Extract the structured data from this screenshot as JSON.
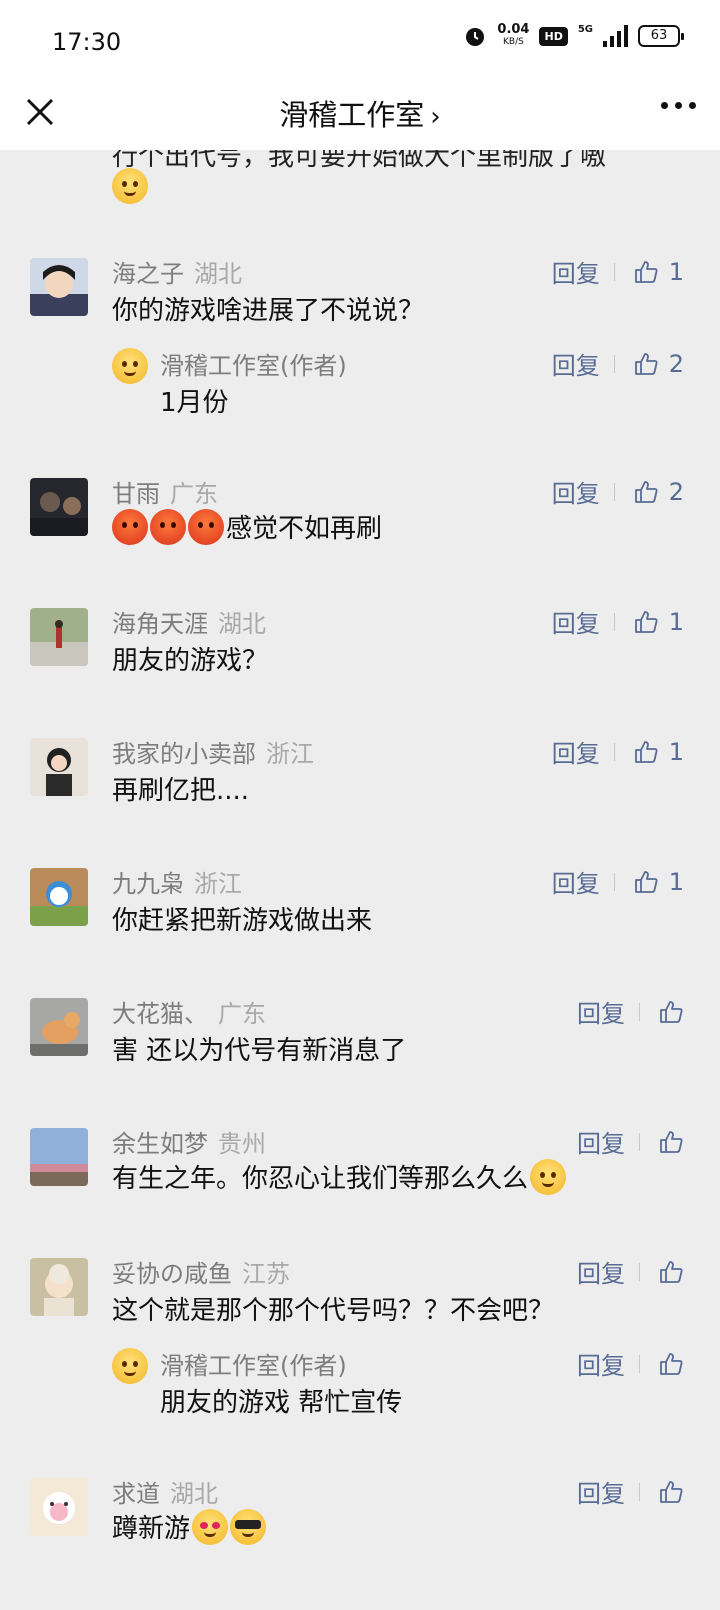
{
  "status_bar": {
    "time": "17:30",
    "net_speed": "0.04",
    "net_unit": "KB/S",
    "hd": "HD",
    "network": "5G",
    "battery": "63"
  },
  "nav": {
    "title": "滑稽工作室",
    "chevron": "›"
  },
  "truncated_comment": {
    "text": "行个出代号，我可要开始做大个里制版了嗷"
  },
  "comments": [
    {
      "author": "海之子",
      "region": "湖北",
      "text": "你的游戏啥进展了不说说？",
      "reply_label": "回复",
      "likes": "1",
      "reply": {
        "author": "滑稽工作室(作者)",
        "text": "1月份",
        "reply_label": "回复",
        "likes": "2"
      }
    },
    {
      "author": "甘雨",
      "region": "广东",
      "text": "感觉不如再刷",
      "reply_label": "回复",
      "likes": "2"
    },
    {
      "author": "海角天涯",
      "region": "湖北",
      "text": "朋友的游戏？",
      "reply_label": "回复",
      "likes": "1"
    },
    {
      "author": "我家的小卖部",
      "region": "浙江",
      "text": "再刷亿把....",
      "reply_label": "回复",
      "likes": "1"
    },
    {
      "author": "九九枭",
      "region": "浙江",
      "text": "你赶紧把新游戏做出来",
      "reply_label": "回复",
      "likes": "1"
    },
    {
      "author": "大花猫、",
      "region": "广东",
      "text": "害 还以为代号有新消息了",
      "reply_label": "回复",
      "likes": ""
    },
    {
      "author": "余生如梦",
      "region": "贵州",
      "text": "有生之年。你忍心让我们等那么久么",
      "reply_label": "回复",
      "likes": ""
    },
    {
      "author": "妥协の咸鱼",
      "region": "江苏",
      "text": "这个就是那个那个代号吗？？不会吧？",
      "reply_label": "回复",
      "likes": "",
      "reply": {
        "author": "滑稽工作室(作者)",
        "text": "朋友的游戏 帮忙宣传",
        "reply_label": "回复",
        "likes": ""
      }
    },
    {
      "author": "求道",
      "region": "湖北",
      "text": "蹲新游",
      "reply_label": "回复",
      "likes": ""
    }
  ],
  "colors": {
    "link": "#576b95",
    "background": "#ededed",
    "meta": "#7d7d7d",
    "region": "#a9a9a9"
  },
  "icons": [
    "close-icon",
    "chevron-right-icon",
    "more-icon",
    "thumb-up-icon",
    "alarm-icon",
    "signal-icon",
    "battery-icon"
  ]
}
